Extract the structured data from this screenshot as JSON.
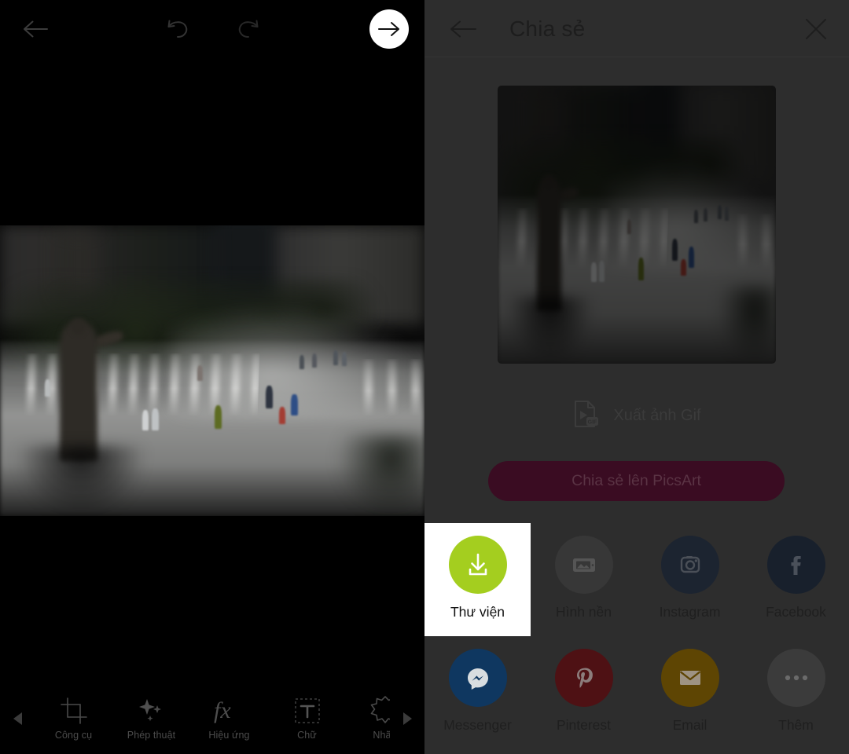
{
  "editor": {
    "topbar": {
      "back_label": "Quay lại",
      "undo_label": "Hoàn tác",
      "redo_label": "Làm lại",
      "next_label": "Tiếp tục"
    },
    "toolbar": {
      "prev_arrow": "◀",
      "next_arrow": "▶",
      "items": [
        {
          "label": "Công cụ",
          "icon": "crop-icon"
        },
        {
          "label": "Phép thuật",
          "icon": "sparkles-icon"
        },
        {
          "label": "Hiệu ứng",
          "icon": "fx-icon"
        },
        {
          "label": "Chữ",
          "icon": "text-box-icon"
        },
        {
          "label": "Nhãn",
          "icon": "sticker-star-icon"
        }
      ]
    }
  },
  "share": {
    "header": {
      "title": "Chia sẻ",
      "back_icon": "arrow-left-icon",
      "close_icon": "close-icon"
    },
    "preview": {
      "alt": "Ảnh xem trước quảng trường đài phun nước"
    },
    "gif_export": {
      "label": "Xuất ảnh Gif",
      "icon": "gif-file-icon"
    },
    "primary_button": {
      "label": "Chia sẻ lên PicsArt",
      "background": "#3a0c22",
      "text_color": "#5a3344"
    },
    "targets": [
      {
        "label": "Thư viện",
        "icon": "download-icon",
        "circle": "#a4ce1f",
        "glyph": "#ffffff",
        "selected": true
      },
      {
        "label": "Hình nền",
        "icon": "wallpaper-icon",
        "circle": "#373737",
        "glyph": "#555555",
        "selected": false
      },
      {
        "label": "Instagram",
        "icon": "instagram-icon",
        "circle": "#1c2430",
        "glyph": "#4a4f57",
        "selected": false
      },
      {
        "label": "Facebook",
        "icon": "facebook-icon",
        "circle": "#18202c",
        "glyph": "#4a505a",
        "selected": false
      },
      {
        "label": "Messenger",
        "icon": "messenger-icon",
        "circle": "#0f3760",
        "glyph": "#9aa2a8",
        "selected": false
      },
      {
        "label": "Pinterest",
        "icon": "pinterest-icon",
        "circle": "#4e1114",
        "glyph": "#8c7d7c",
        "selected": false
      },
      {
        "label": "Email",
        "icon": "envelope-icon",
        "circle": "#5e4503",
        "glyph": "#9e9383",
        "selected": false
      },
      {
        "label": "Thêm",
        "icon": "more-dots-icon",
        "circle": "#3b3b3b",
        "glyph": "#6a6a6a",
        "selected": false
      }
    ]
  }
}
